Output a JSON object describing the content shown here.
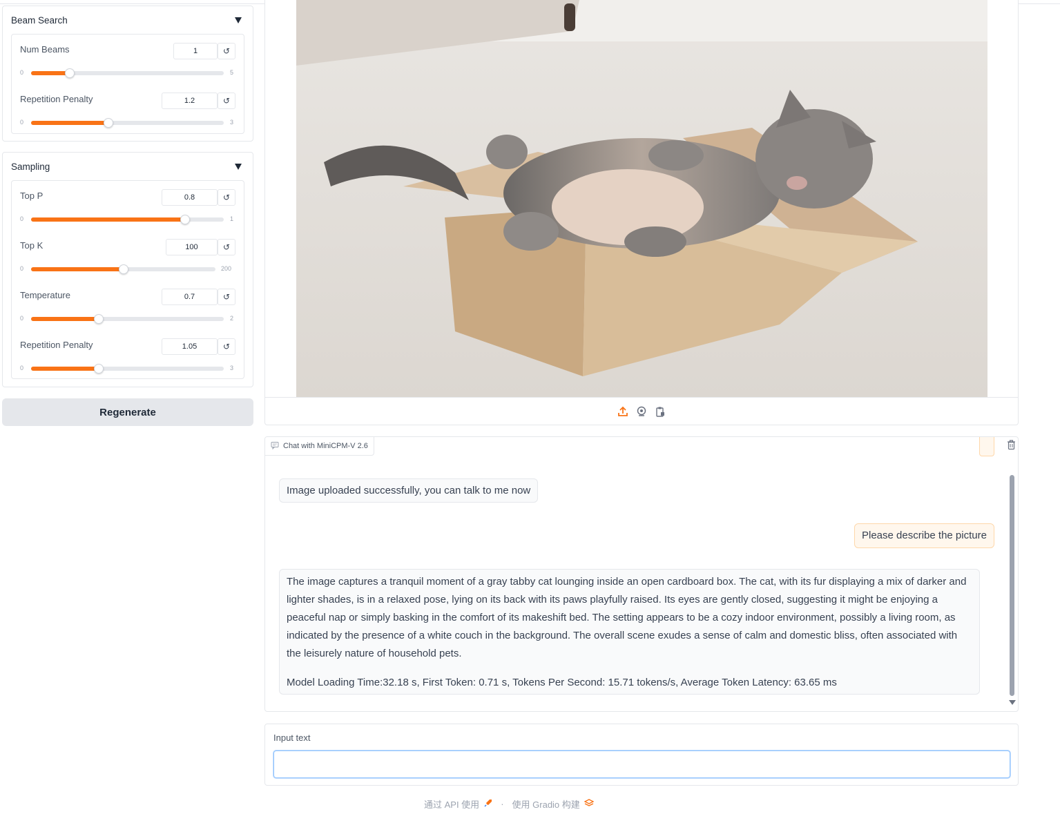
{
  "beam_search": {
    "title": "Beam Search",
    "num_beams": {
      "label": "Num Beams",
      "value": "1",
      "min": "0",
      "max": "5",
      "fraction": 0.2
    },
    "repetition_penalty": {
      "label": "Repetition Penalty",
      "value": "1.2",
      "min": "0",
      "max": "3",
      "fraction": 0.4
    }
  },
  "sampling": {
    "title": "Sampling",
    "top_p": {
      "label": "Top P",
      "value": "0.8",
      "min": "0",
      "max": "1",
      "fraction": 0.8
    },
    "top_k": {
      "label": "Top K",
      "value": "100",
      "min": "0",
      "max": "200",
      "fraction": 0.5
    },
    "temperature": {
      "label": "Temperature",
      "value": "0.7",
      "min": "0",
      "max": "2",
      "fraction": 0.35
    },
    "repetition_penalty": {
      "label": "Repetition Penalty",
      "value": "1.05",
      "min": "0",
      "max": "3",
      "fraction": 0.35
    }
  },
  "regenerate_label": "Regenerate",
  "image_toolbar": {
    "icons": [
      "upload-icon",
      "webcam-icon",
      "clipboard-icon"
    ]
  },
  "chat": {
    "label": "Chat with MiniCPM-V 2.6",
    "messages": [
      {
        "role": "bot",
        "text": "Image uploaded successfully, you can talk to me now"
      },
      {
        "role": "user",
        "text": "Please describe the picture"
      },
      {
        "role": "bot",
        "text": "The image captures a tranquil moment of a gray tabby cat lounging inside an open cardboard box. The cat, with its fur displaying a mix of darker and lighter shades, is in a relaxed pose, lying on its back with its paws playfully raised. Its eyes are gently closed, suggesting it might be enjoying a peaceful nap or simply basking in the comfort of its makeshift bed. The setting appears to be a cozy indoor environment, possibly a living room, as indicated by the presence of a white couch in the background. The overall scene exudes a sense of calm and domestic bliss, often associated with the leisurely nature of household pets.",
        "stats": "Model Loading Time:32.18 s, First Token: 0.71 s, Tokens Per Second: 15.71 tokens/s, Average Token Latency: 63.65 ms"
      }
    ]
  },
  "input": {
    "label": "Input text",
    "value": "",
    "placeholder": ""
  },
  "footer": {
    "api": "通过 API 使用",
    "sep": "·",
    "built": "使用 Gradio 构建"
  },
  "colors": {
    "accent": "#f97316",
    "user_bubble": "#fff7ed",
    "bot_bubble": "#f9fafb"
  }
}
